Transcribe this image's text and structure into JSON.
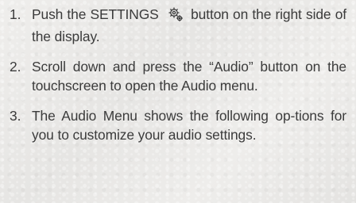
{
  "steps": [
    {
      "number": "1.",
      "before_icon": "Push the SETTINGS",
      "icon": "gear-icon",
      "after_icon": "button on the right side of the display."
    },
    {
      "number": "2.",
      "text": "Scroll down and press the “Audio” button on the touchscreen to open the Audio menu."
    },
    {
      "number": "3.",
      "text": "The Audio Menu shows the following op-tions for you to customize your audio settings."
    }
  ],
  "colors": {
    "text": "#3b3b3b",
    "background": "#ecebe9"
  }
}
